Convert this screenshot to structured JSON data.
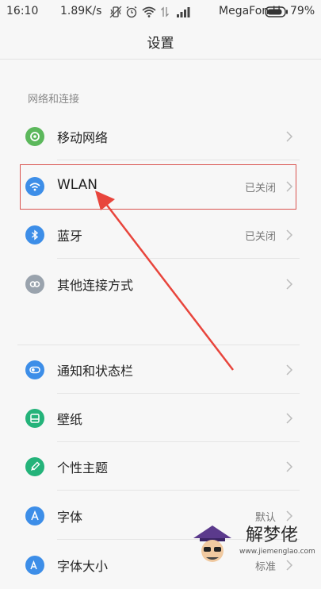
{
  "status_bar": {
    "time": "16:10",
    "speed": "1.89K/s",
    "carrier": "MegaFon H",
    "battery": "79%"
  },
  "title": "设置",
  "section_network": "网络和连接",
  "network_items": [
    {
      "label": "移动网络",
      "value": "",
      "icon": "mobile-network-icon",
      "color": "#5cb85c"
    },
    {
      "label": "WLAN",
      "value": "已关闭",
      "icon": "wifi-icon",
      "color": "#3d8ee8"
    },
    {
      "label": "蓝牙",
      "value": "已关闭",
      "icon": "bluetooth-icon",
      "color": "#3d8ee8"
    },
    {
      "label": "其他连接方式",
      "value": "",
      "icon": "link-icon",
      "color": "#9aa3ad"
    }
  ],
  "personal_items": [
    {
      "label": "通知和状态栏",
      "value": "",
      "icon": "notification-toggle-icon",
      "color": "#3d8ee8"
    },
    {
      "label": "壁纸",
      "value": "",
      "icon": "wallpaper-icon",
      "color": "#24b37a"
    },
    {
      "label": "个性主题",
      "value": "",
      "icon": "theme-brush-icon",
      "color": "#24b37a"
    },
    {
      "label": "字体",
      "value": "默认",
      "icon": "font-icon",
      "color": "#3d8ee8"
    },
    {
      "label": "字体大小",
      "value": "标准",
      "icon": "font-size-icon",
      "color": "#3d8ee8"
    }
  ],
  "watermark": {
    "title": "解梦佬",
    "url": "www.jiemenglao.com"
  },
  "annotation_color": "#e8453c"
}
